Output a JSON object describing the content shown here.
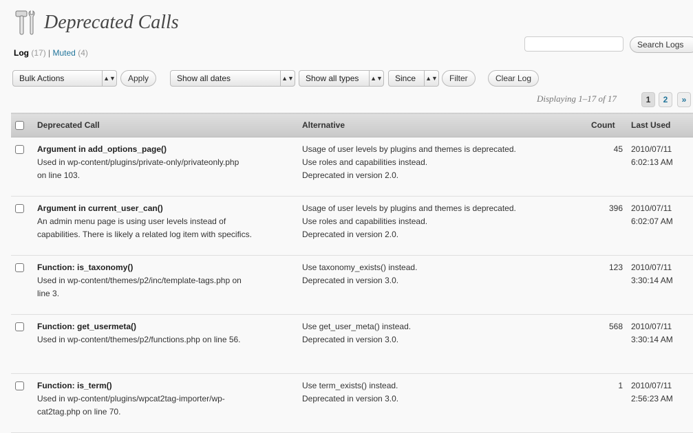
{
  "page": {
    "title": "Deprecated Calls"
  },
  "views": {
    "log_label": "Log",
    "log_count": "(17)",
    "separator": "|",
    "muted_label": "Muted",
    "muted_count": "(4)"
  },
  "search": {
    "value": "",
    "placeholder": "",
    "button": "Search Logs"
  },
  "toolbar": {
    "bulk_actions": "Bulk Actions",
    "apply": "Apply",
    "dates": "Show all dates",
    "types": "Show all types",
    "since": "Since",
    "filter": "Filter",
    "clear_log": "Clear Log"
  },
  "pagination": {
    "displaying": "Displaying 1–17 of 17",
    "pages": [
      "1",
      "2"
    ],
    "next": "»"
  },
  "table": {
    "headers": {
      "call": "Deprecated Call",
      "alternative": "Alternative",
      "count": "Count",
      "last_used": "Last Used"
    },
    "rows": [
      {
        "title": "Argument in add_options_page()",
        "desc1": "Used in wp-content/plugins/private-only/privateonly.php",
        "desc2": "on line 103.",
        "alt1": "Usage of user levels by plugins and themes is deprecated.",
        "alt2": "Use roles and capabilities instead.",
        "alt3": "Deprecated in version 2.0.",
        "count": "45",
        "date": "2010/07/11",
        "time": "6:02:13 AM"
      },
      {
        "title": "Argument in current_user_can()",
        "desc1": "An admin menu page is using user levels instead of",
        "desc2": "capabilities. There is likely a related log item with specifics.",
        "alt1": "Usage of user levels by plugins and themes is deprecated.",
        "alt2": "Use roles and capabilities instead.",
        "alt3": "Deprecated in version 2.0.",
        "count": "396",
        "date": "2010/07/11",
        "time": "6:02:07 AM"
      },
      {
        "title": "Function: is_taxonomy()",
        "desc1": "Used in wp-content/themes/p2/inc/template-tags.php on",
        "desc2": "line 3.",
        "alt1": "Use taxonomy_exists() instead.",
        "alt2": "Deprecated in version 3.0.",
        "alt3": "",
        "count": "123",
        "date": "2010/07/11",
        "time": "3:30:14 AM"
      },
      {
        "title": "Function: get_usermeta()",
        "desc1": "Used in wp-content/themes/p2/functions.php on line 56.",
        "desc2": "",
        "alt1": "Use get_user_meta() instead.",
        "alt2": "Deprecated in version 3.0.",
        "alt3": "",
        "count": "568",
        "date": "2010/07/11",
        "time": "3:30:14 AM"
      },
      {
        "title": "Function: is_term()",
        "desc1": "Used in wp-content/plugins/wpcat2tag-importer/wp-",
        "desc2": "cat2tag.php on line 70.",
        "alt1": "Use term_exists() instead.",
        "alt2": "Deprecated in version 3.0.",
        "alt3": "",
        "count": "1",
        "date": "2010/07/11",
        "time": "2:56:23 AM"
      }
    ]
  }
}
